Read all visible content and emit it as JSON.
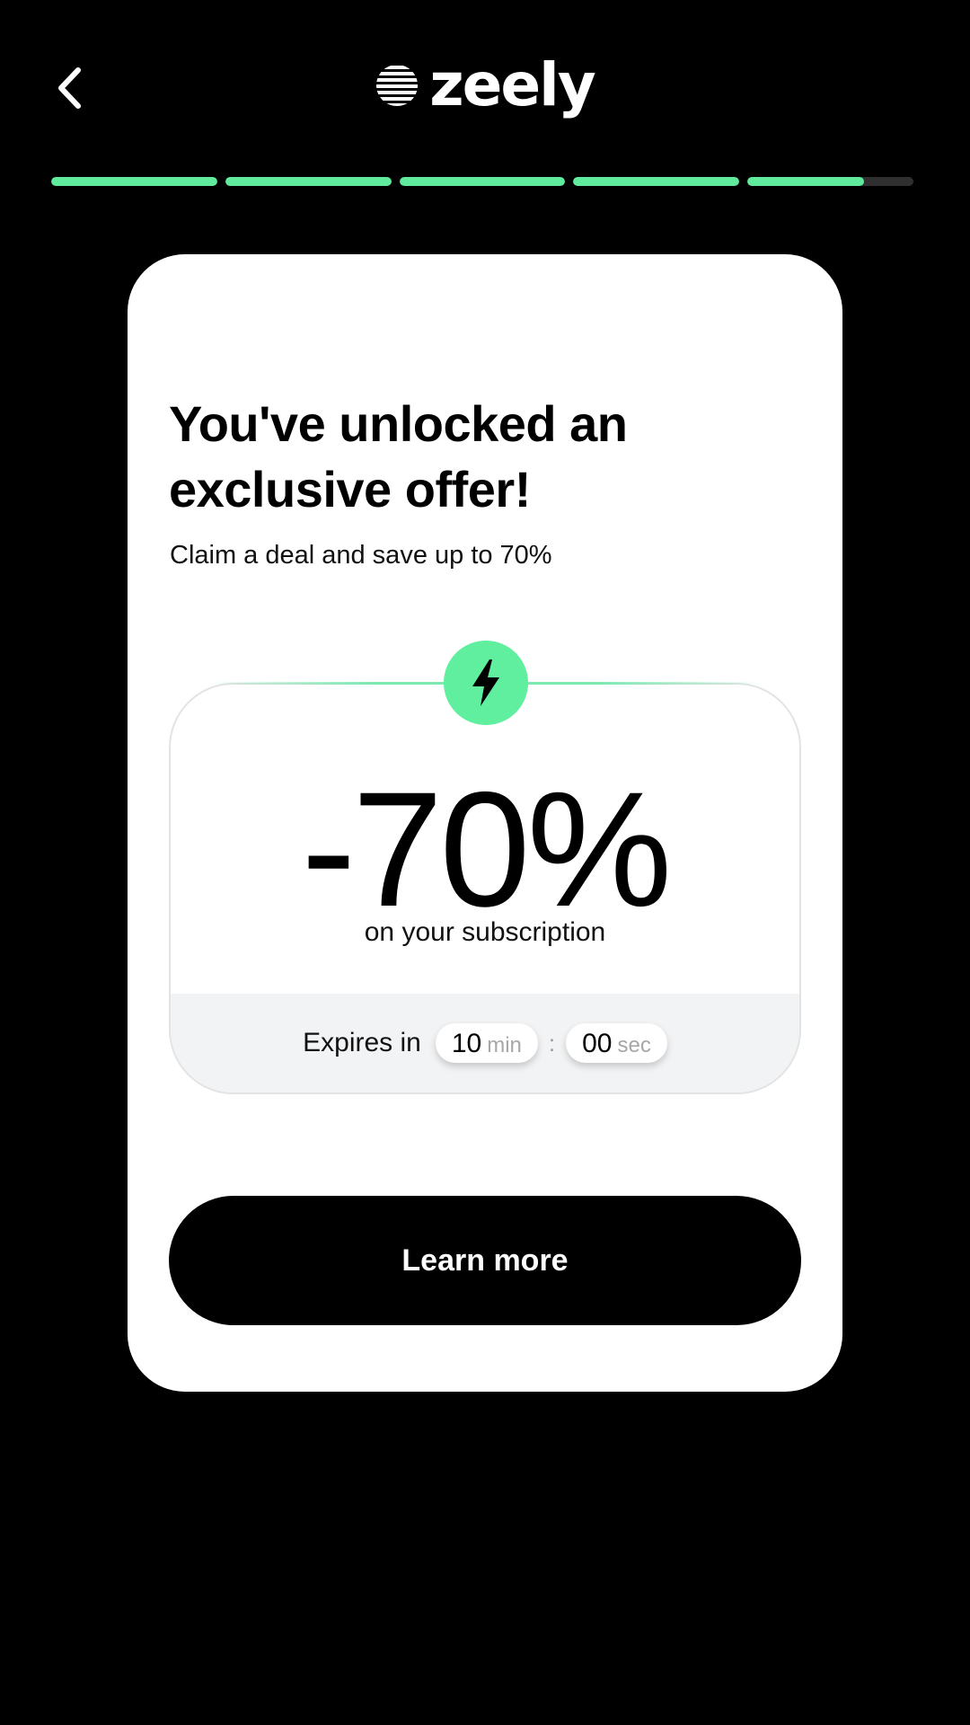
{
  "header": {
    "back_icon": "chevron-left-icon",
    "logo_text": "zeely",
    "logo_icon": "striped-globe-icon"
  },
  "progress": {
    "segments": [
      1,
      1,
      1,
      1,
      0.7
    ],
    "fill_color": "#5fea9e",
    "track_color": "#2f2f2f"
  },
  "offer": {
    "title": "You've unlocked an exclusive offer!",
    "subtitle": "Claim a deal and save up to 70%",
    "badge_icon": "lightning-bolt-icon",
    "discount": "-70%",
    "discount_caption": "on your subscription",
    "expires_label": "Expires in",
    "timer": {
      "minutes": "10",
      "minutes_unit": "min",
      "separator": ":",
      "seconds": "00",
      "seconds_unit": "sec"
    },
    "cta_label": "Learn more"
  },
  "colors": {
    "accent": "#5fef9f",
    "background": "#000000",
    "card": "#ffffff"
  }
}
